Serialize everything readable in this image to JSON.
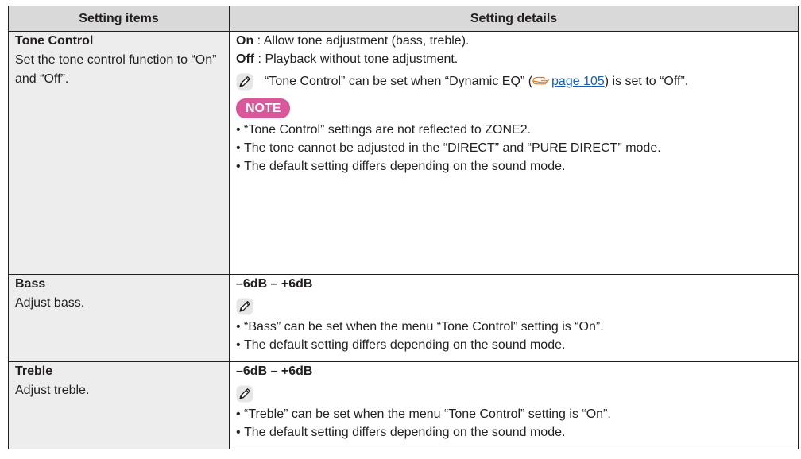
{
  "table": {
    "header_items": "Setting items",
    "header_details": "Setting details"
  },
  "rows": [
    {
      "name": "Tone Control",
      "desc": "Set the tone control function to “On” and “Off”.",
      "options": [
        {
          "key": "On",
          "text": " : Allow tone adjustment (bass, treble)."
        },
        {
          "key": "Off",
          "text": " : Playback without tone adjustment."
        }
      ],
      "tip_before": "“Tone Control” can be set when “Dynamic EQ” (",
      "tip_link": "page 105",
      "tip_after": ") is set to “Off”.",
      "note_label": "NOTE",
      "bullets": [
        "“Tone Control” settings are not reflected to ZONE2.",
        "The tone cannot be adjusted in the “DIRECT” and “PURE DIRECT” mode.",
        "The default setting differs depending on the sound mode."
      ]
    },
    {
      "name": "Bass",
      "desc": "Adjust bass.",
      "range": "–6dB – +6dB",
      "bullets": [
        "“Bass” can be set when the menu “Tone Control” setting is “On”.",
        "The default setting differs depending on the sound mode."
      ]
    },
    {
      "name": "Treble",
      "desc": "Adjust treble.",
      "range": "–6dB – +6dB",
      "bullets": [
        "“Treble” can be set when the menu “Tone Control” setting is “On”.",
        "The default setting differs depending on the sound mode."
      ]
    }
  ],
  "icons": {
    "tip": "pencil-icon",
    "reference": "page-reference-hand-icon"
  },
  "colors": {
    "header_bg": "#d9d9d9",
    "item_bg": "#ededed",
    "note_badge": "#d9579a",
    "link": "#1a5fb4"
  }
}
